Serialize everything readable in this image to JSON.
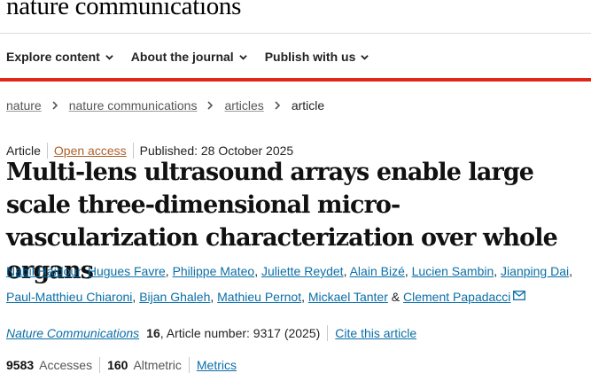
{
  "brand": {
    "name": "nature communications"
  },
  "nav": {
    "items": [
      {
        "label": "Explore content"
      },
      {
        "label": "About the journal"
      },
      {
        "label": "Publish with us"
      }
    ]
  },
  "breadcrumb": {
    "items": [
      "nature",
      "nature communications",
      "articles"
    ],
    "current": "article"
  },
  "article_meta": {
    "type": "Article",
    "access": "Open access",
    "published": "Published: 28 October 2025"
  },
  "title": "Multi-lens ultrasound arrays enable large scale three-dimensional micro-vascularization characterization over whole organs",
  "authors": [
    "Nabil Haidour",
    "Hugues Favre",
    "Philippe Mateo",
    "Juliette Reydet",
    "Alain Bizé",
    "Lucien Sambin",
    "Jianping Dai",
    "Paul-Matthieu Chiaroni",
    "Bijan Ghaleh",
    "Mathieu Pernot",
    "Mickael Tanter",
    "Clement Papadacci"
  ],
  "authors_sep": {
    "comma": ",",
    "amp": "&"
  },
  "citation": {
    "journal": "Nature Communications",
    "volume": "16",
    "article_number": ", Article number: 9317 (2025)",
    "cite_label": "Cite this article"
  },
  "metrics": {
    "accesses_value": "9583",
    "accesses_label": "Accesses",
    "altmetric_value": "160",
    "altmetric_label": "Altmetric",
    "metrics_link": "Metrics"
  },
  "colors": {
    "accent_red": "#e0251b",
    "link_blue": "#0b6fa8",
    "open_access": "#b0602a"
  }
}
